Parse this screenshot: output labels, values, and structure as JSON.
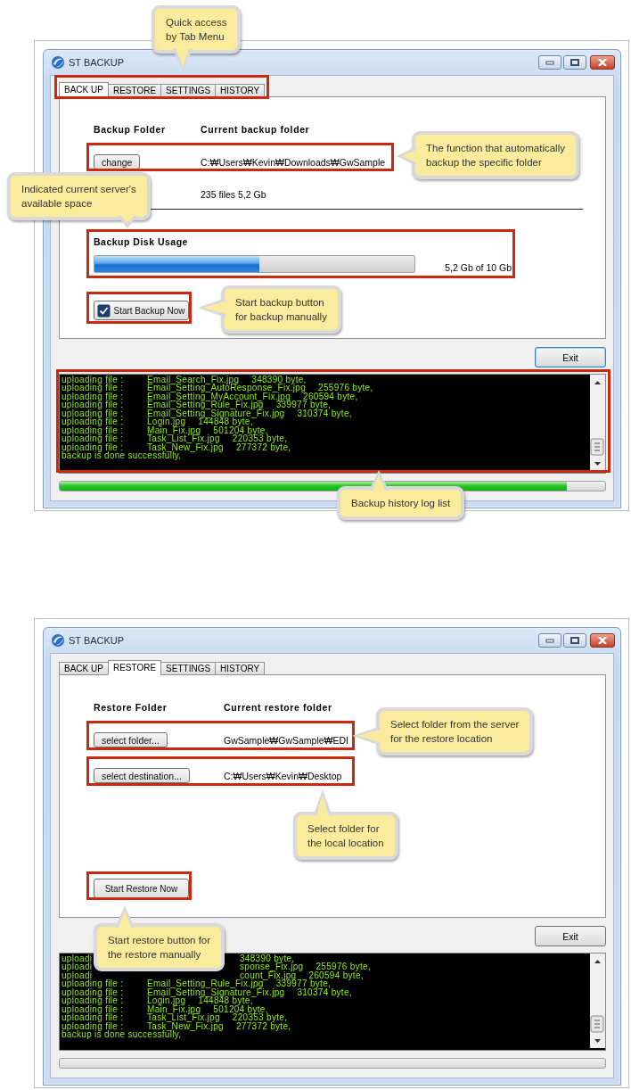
{
  "windows": [
    {
      "kind": "backup",
      "title": "ST BACKUP",
      "tabs": [
        {
          "label": "BACK UP",
          "selected": true
        },
        {
          "label": "RESTORE",
          "selected": false
        },
        {
          "label": "SETTINGS",
          "selected": false
        },
        {
          "label": "HISTORY",
          "selected": false
        }
      ],
      "columns": [
        "Backup Folder",
        "Current backup folder"
      ],
      "folders": [
        {
          "button": "change",
          "path": "C:₩Users₩Kevin₩Downloads₩GwSample"
        }
      ],
      "summary": "235 files 5,2 Gb",
      "usage": {
        "title": "Backup Disk Usage",
        "level": 0.515,
        "reading": "5,2 Gb of 10 Gb"
      },
      "start_button": {
        "label": "Start Backup Now",
        "checked": true
      },
      "exit_button": {
        "label": "Exit",
        "focused": true
      },
      "log": [
        {
          "kind": "file",
          "label": "uploading file :",
          "file": "Email_Search_Fix.jpg",
          "size": "348390 byte,"
        },
        {
          "kind": "file",
          "label": "uploading file :",
          "file": "Email_Setting_AutoResponse_Fix.jpg",
          "size": "255976 byte,"
        },
        {
          "kind": "file",
          "label": "uploading file :",
          "file": "Email_Setting_MyAccount_Fix.jpg",
          "size": "260594 byte,"
        },
        {
          "kind": "file",
          "label": "uploading file :",
          "file": "Email_Setting_Rule_Fix.jpg",
          "size": "339977 byte,"
        },
        {
          "kind": "file",
          "label": "uploading file :",
          "file": "Email_Setting_Signature_Fix.jpg",
          "size": "310374 byte,"
        },
        {
          "kind": "file",
          "label": "uploading file :",
          "file": "Login.jpg",
          "size": "144848 byte,"
        },
        {
          "kind": "file",
          "label": "uploading file :",
          "file": "Main_Fix.jpg",
          "size": "501204 byte,"
        },
        {
          "kind": "file",
          "label": "uploading file :",
          "file": "Task_List_Fix.jpg",
          "size": "220353 byte,"
        },
        {
          "kind": "file",
          "label": "uploading file :",
          "file": "Task_New_Fix.jpg",
          "size": "277372 byte,"
        },
        {
          "kind": "message",
          "text": "backup is done successfully,"
        }
      ],
      "progress": {
        "level": 0.93
      }
    },
    {
      "kind": "restore",
      "title": "ST BACKUP",
      "tabs": [
        {
          "label": "BACK UP",
          "selected": false
        },
        {
          "label": "RESTORE",
          "selected": true
        },
        {
          "label": "SETTINGS",
          "selected": false
        },
        {
          "label": "HISTORY",
          "selected": false
        }
      ],
      "columns": [
        "Restore Folder",
        "Current restore folder"
      ],
      "folders": [
        {
          "button": "select folder...",
          "path": "GwSample₩GwSample₩EDI"
        },
        {
          "button": "select destination...",
          "path": "C:₩Users₩Kevin₩Desktop"
        }
      ],
      "start_button": {
        "label": "Start Restore Now"
      },
      "exit_button": {
        "label": "Exit",
        "focused": false
      },
      "log": [
        {
          "kind": "clipped",
          "label": "uploadi",
          "size": "348390 byte,"
        },
        {
          "kind": "clipped",
          "label": "uploadi",
          "file": "sponse_Fix.jpg",
          "size": "255976 byte,"
        },
        {
          "kind": "clipped",
          "label": "uploadi",
          "file": "count_Fix.jpg",
          "size": "260594 byte,"
        },
        {
          "kind": "file",
          "label": "uploading file :",
          "file": "Email_Setting_Rule_Fix.jpg",
          "size": "339977 byte,"
        },
        {
          "kind": "file",
          "label": "uploading file :",
          "file": "Email_Setting_Signature_Fix.jpg",
          "size": "310374 byte,"
        },
        {
          "kind": "file",
          "label": "uploading file :",
          "file": "Login.jpg",
          "size": "144848 byte,"
        },
        {
          "kind": "file",
          "label": "uploading file :",
          "file": "Main_Fix.jpg",
          "size": "501204 byte,"
        },
        {
          "kind": "file",
          "label": "uploading file :",
          "file": "Task_List_Fix.jpg",
          "size": "220353 byte,"
        },
        {
          "kind": "file",
          "label": "uploading file :",
          "file": "Task_New_Fix.jpg",
          "size": "277372 byte,"
        },
        {
          "kind": "message",
          "text": "backup is done successfully,"
        }
      ],
      "progress": {
        "level": 0
      }
    }
  ],
  "callouts": [
    {
      "text": "Quick access\nby Tab Menu",
      "kind": "down"
    },
    {
      "text": "The function that automatically\nbackup the specific folder",
      "kind": "left"
    },
    {
      "text": "Indicated current server's\navailable space",
      "kind": "down"
    },
    {
      "text": "Start backup button\nfor backup manually",
      "kind": "left"
    },
    {
      "text": "Backup history log list",
      "kind": "up"
    },
    {
      "text": "Select folder from the server\nfor the restore location",
      "kind": "left"
    },
    {
      "text": "Select folder for\nthe local location",
      "kind": "up"
    },
    {
      "text": "Start restore button for\nthe restore manually",
      "kind": "up"
    }
  ]
}
